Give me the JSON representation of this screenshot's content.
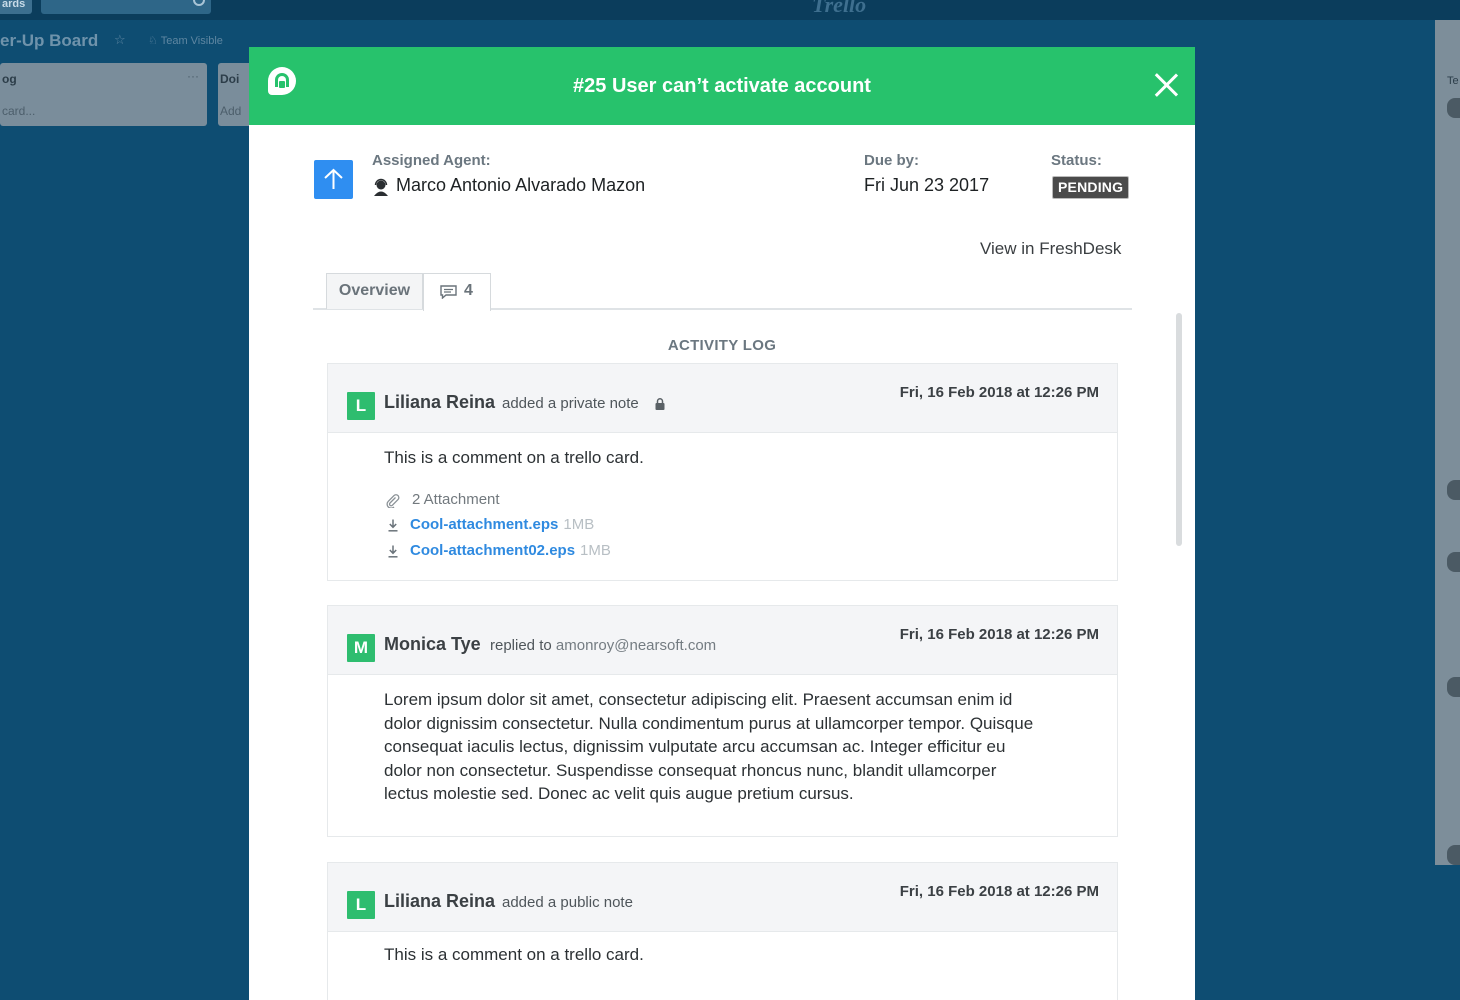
{
  "background": {
    "boards_button": "ards",
    "board_title": "er-Up Board",
    "visibility": "Team Visible",
    "lists": [
      {
        "title": "og",
        "add_card": "card..."
      },
      {
        "title": "Doi",
        "add_card": "Add"
      }
    ],
    "right_panel_label": "Te",
    "logo": "Trello"
  },
  "modal": {
    "title": "#25 User can’t activate account",
    "assigned_agent_label": "Assigned Agent:",
    "assigned_agent": "Marco Antonio Alvarado Mazon",
    "due_label": "Due by:",
    "due_value": "Fri Jun 23 2017",
    "status_label": "Status:",
    "status_value": "PENDING",
    "view_link": "View in FreshDesk",
    "tabs": [
      {
        "label": "Overview"
      },
      {
        "label": "4",
        "icon": "comment-icon"
      }
    ],
    "activity_title": "ACTIVITY LOG",
    "entries": [
      {
        "avatar": "L",
        "author": "Liliana Reina",
        "action": "added a private note",
        "date": "Fri, 16 Feb 2018 at 12:26 PM",
        "body": "This is a comment on a trello card.",
        "attachments_label": "2 Attachment",
        "attachments": [
          {
            "name": "Cool-attachment.eps",
            "size": "1MB"
          },
          {
            "name": "Cool-attachment02.eps",
            "size": "1MB"
          }
        ]
      },
      {
        "avatar": "M",
        "author": "Monica Tye",
        "action": "replied to",
        "email": "amonroy@nearsoft.com",
        "date": "Fri, 16 Feb 2018 at 12:26 PM",
        "body_lines": [
          "Lorem ipsum dolor sit amet, consectetur adipiscing elit. Praesent accumsan enim id",
          "dolor dignissim consectetur. Nulla condimentum purus at ullamcorper tempor. Quisque",
          "consequat iaculis lectus, dignissim vulputate arcu accumsan ac. Integer efficitur eu",
          "dolor non consectetur. Suspendisse consequat rhoncus nunc, blandit ullamcorper",
          "lectus molestie sed. Donec ac velit quis augue pretium cursus."
        ]
      },
      {
        "avatar": "L",
        "author": "Liliana Reina",
        "action": "added a public note",
        "date": "Fri, 16 Feb 2018 at 12:26 PM",
        "body": "This is a comment on a trello card."
      }
    ]
  },
  "colors": {
    "header_green": "#27c26c",
    "avatar_green": "#2ebd6f",
    "priority_blue": "#2f8ef1",
    "link_blue": "#2f8ae0",
    "status_badge": "#4b4b4b",
    "backdrop": "#0e4d72"
  }
}
